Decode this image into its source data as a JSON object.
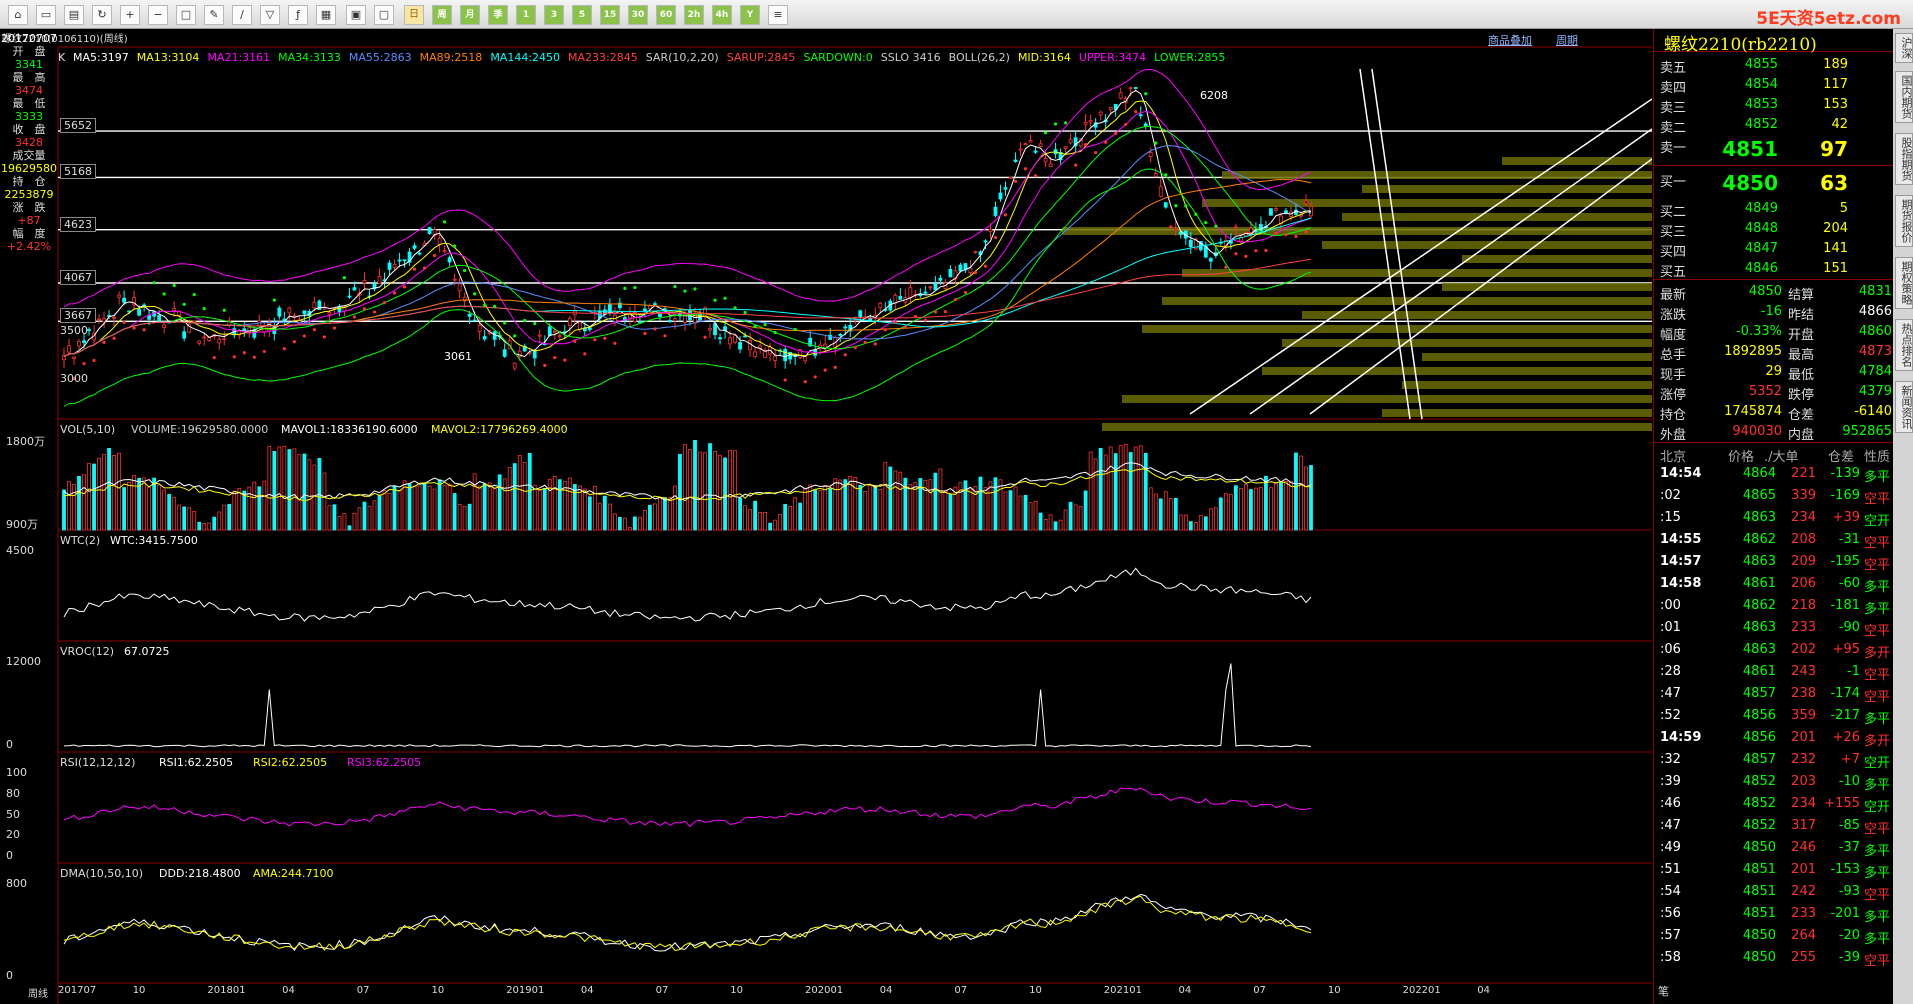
{
  "toolbar": {
    "icons": [
      "home-icon",
      "folder-icon",
      "chart-icon",
      "refresh-icon",
      "zoom-in-icon",
      "zoom-out-icon",
      "window-icon",
      "pencil-icon",
      "brush-icon",
      "filter-icon",
      "formula-icon",
      "table-icon",
      "calc-icon",
      "box-icon",
      "day-label",
      "week-label",
      "month-label",
      "x-label",
      "1-label",
      "3-label",
      "5-label",
      "15-label",
      "30-label",
      "60-label",
      "2h-label",
      "4h-label",
      "y-label",
      "news-icon"
    ],
    "period_buttons": [
      "日",
      "周",
      "月",
      "季",
      "1",
      "3",
      "5",
      "15",
      "30",
      "60",
      "2h",
      "4h",
      "Y"
    ]
  },
  "watermark": "5E天资5etz.com",
  "header": {
    "title": "螺纹2210(0106110)(周线)",
    "k_label": "K",
    "ma_items": [
      {
        "text": "MA5:3197",
        "color": "#ffffff"
      },
      {
        "text": "MA13:3104",
        "color": "#ffff00"
      },
      {
        "text": "MA21:3161",
        "color": "#ff00ff"
      },
      {
        "text": "MA34:3133",
        "color": "#00ff00"
      },
      {
        "text": "MA55:2863",
        "color": "#5a8cff"
      },
      {
        "text": "MA89:2518",
        "color": "#ff8000"
      },
      {
        "text": "MA144:2450",
        "color": "#00ffff"
      },
      {
        "text": "MA233:2845",
        "color": "#ff4040"
      },
      {
        "text": "SAR(10,2,20)",
        "color": "#cccccc"
      },
      {
        "text": "SARUP:2845",
        "color": "#ff4040"
      },
      {
        "text": "SARDOWN:0",
        "color": "#00ff00"
      },
      {
        "text": "SSLO 3416",
        "color": "#cccccc"
      },
      {
        "text": "BOLL(26,2)",
        "color": "#cccccc"
      },
      {
        "text": "MID:3164",
        "color": "#ffff00"
      },
      {
        "text": "UPPER:3474",
        "color": "#ff00ff"
      },
      {
        "text": "LOWER:2855",
        "color": "#00ff00"
      }
    ],
    "link_overlay": "商品叠加",
    "link_period": "周期"
  },
  "left_info": {
    "date": "20170707",
    "rows": [
      {
        "label": "开　盘",
        "value": "3341",
        "color": "#00ff00"
      },
      {
        "label": "最　高",
        "value": "3474",
        "color": "#ff3030"
      },
      {
        "label": "最　低",
        "value": "3333",
        "color": "#00ff00"
      },
      {
        "label": "收　盘",
        "value": "3428",
        "color": "#ff3030"
      },
      {
        "label": "成交量",
        "value": "19629580",
        "color": "#ffff00"
      },
      {
        "label": "持　仓",
        "value": "2253879",
        "color": "#ffff00"
      },
      {
        "label": "涨　跌",
        "value": "+87",
        "color": "#ff3030"
      },
      {
        "label": "幅　度",
        "value": "+2.42%",
        "color": "#ff3030"
      }
    ]
  },
  "main_chart": {
    "levels": [
      "5652",
      "5168",
      "4623",
      "4067",
      "3667",
      "3500",
      "3000"
    ],
    "peak_label": "6208",
    "low_label": "3061"
  },
  "panels": {
    "vol": {
      "title": "VOL(5,10)",
      "items": [
        {
          "text": "VOLUME:19629580.0000",
          "color": "#cccccc"
        },
        {
          "text": "MAVOL1:18336190.6000",
          "color": "#ffffff"
        },
        {
          "text": "MAVOL2:17796269.4000",
          "color": "#ffff00"
        }
      ],
      "ticks": [
        "1800万",
        "900万"
      ]
    },
    "wtc": {
      "title": "WTC(2)",
      "items": [
        {
          "text": "WTC:3415.7500",
          "color": "#ffffff"
        }
      ],
      "ticks": [
        "4500"
      ]
    },
    "vroc": {
      "title": "VROC(12)",
      "items": [
        {
          "text": "67.0725",
          "color": "#ffffff"
        }
      ],
      "ticks": [
        "12000",
        "0"
      ]
    },
    "rsi": {
      "title": "RSI(12,12,12)",
      "items": [
        {
          "text": "RSI1:62.2505",
          "color": "#ffffff"
        },
        {
          "text": "RSI2:62.2505",
          "color": "#ffff00"
        },
        {
          "text": "RSI3:62.2505",
          "color": "#ff00ff"
        }
      ],
      "ticks": [
        "100",
        "80",
        "50",
        "20",
        "0"
      ]
    },
    "dma": {
      "title": "DMA(10,50,10)",
      "items": [
        {
          "text": "DDD:218.4800",
          "color": "#ffffff"
        },
        {
          "text": "AMA:244.7100",
          "color": "#ffff00"
        }
      ],
      "ticks": [
        "800",
        "0"
      ]
    }
  },
  "x_axis": [
    "周线",
    "201707",
    "10",
    "201801",
    "04",
    "07",
    "10",
    "201901",
    "04",
    "07",
    "10",
    "202001",
    "04",
    "07",
    "10",
    "202101",
    "04",
    "07",
    "10",
    "202201",
    "04"
  ],
  "quote": {
    "title": "螺纹2210(rb2210)",
    "asks": [
      {
        "label": "卖五",
        "price": "4855",
        "vol": "189"
      },
      {
        "label": "卖四",
        "price": "4854",
        "vol": "117"
      },
      {
        "label": "卖三",
        "price": "4853",
        "vol": "153"
      },
      {
        "label": "卖二",
        "price": "4852",
        "vol": "42"
      },
      {
        "label": "卖一",
        "price": "4851",
        "vol": "97"
      }
    ],
    "bids": [
      {
        "label": "买一",
        "price": "4850",
        "vol": "63"
      },
      {
        "label": "买二",
        "price": "4849",
        "vol": "5"
      },
      {
        "label": "买三",
        "price": "4848",
        "vol": "204"
      },
      {
        "label": "买四",
        "price": "4847",
        "vol": "141"
      },
      {
        "label": "买五",
        "price": "4846",
        "vol": "151"
      }
    ],
    "stats": [
      {
        "l1": "最新",
        "v1": "4850",
        "c1": "#00ff00",
        "l2": "结算",
        "v2": "4831",
        "c2": "#00ff00"
      },
      {
        "l1": "涨跌",
        "v1": "-16",
        "c1": "#00ff00",
        "l2": "昨结",
        "v2": "4866",
        "c2": "#ffffff"
      },
      {
        "l1": "幅度",
        "v1": "-0.33%",
        "c1": "#00ff00",
        "l2": "开盘",
        "v2": "4860",
        "c2": "#00ff00"
      },
      {
        "l1": "总手",
        "v1": "1892895",
        "c1": "#ffff00",
        "l2": "最高",
        "v2": "4873",
        "c2": "#ff3030"
      },
      {
        "l1": "现手",
        "v1": "29",
        "c1": "#ffff00",
        "l2": "最低",
        "v2": "4784",
        "c2": "#00ff00"
      },
      {
        "l1": "涨停",
        "v1": "5352",
        "c1": "#ff3030",
        "l2": "跌停",
        "v2": "4379",
        "c2": "#00ff00"
      },
      {
        "l1": "持仓",
        "v1": "1745874",
        "c1": "#ffff00",
        "l2": "仓差",
        "v2": "-6140",
        "c2": "#ffff00"
      },
      {
        "l1": "外盘",
        "v1": "940030",
        "c1": "#ff3030",
        "l2": "内盘",
        "v2": "952865",
        "c2": "#00ff00"
      }
    ],
    "ticks_header": [
      "北京",
      "价格",
      "./大单",
      "仓差",
      "性质"
    ],
    "ticks": [
      {
        "t": "14:54",
        "p": "4864",
        "v": "221",
        "d": "-139",
        "n": "多平",
        "nc": "#00ff00",
        "big": true
      },
      {
        "t": ":02",
        "p": "4865",
        "v": "339",
        "d": "-169",
        "n": "空平",
        "nc": "#ff3030",
        "big": false
      },
      {
        "t": ":15",
        "p": "4863",
        "v": "234",
        "d": "+39",
        "n": "空开",
        "nc": "#00ff00",
        "big": false
      },
      {
        "t": "14:55",
        "p": "4862",
        "v": "208",
        "d": "-31",
        "n": "空平",
        "nc": "#ff3030",
        "big": true
      },
      {
        "t": "14:57",
        "p": "4863",
        "v": "209",
        "d": "-195",
        "n": "空平",
        "nc": "#ff3030",
        "big": true
      },
      {
        "t": "14:58",
        "p": "4861",
        "v": "206",
        "d": "-60",
        "n": "多平",
        "nc": "#00ff00",
        "big": true
      },
      {
        "t": ":00",
        "p": "4862",
        "v": "218",
        "d": "-181",
        "n": "多平",
        "nc": "#00ff00",
        "big": false
      },
      {
        "t": ":01",
        "p": "4863",
        "v": "233",
        "d": "-90",
        "n": "空平",
        "nc": "#ff3030",
        "big": false
      },
      {
        "t": ":06",
        "p": "4863",
        "v": "202",
        "d": "+95",
        "n": "多开",
        "nc": "#ff3030",
        "big": false
      },
      {
        "t": ":28",
        "p": "4861",
        "v": "243",
        "d": "-1",
        "n": "空平",
        "nc": "#ff3030",
        "big": false
      },
      {
        "t": ":47",
        "p": "4857",
        "v": "238",
        "d": "-174",
        "n": "空平",
        "nc": "#ff3030",
        "big": false
      },
      {
        "t": ":52",
        "p": "4856",
        "v": "359",
        "d": "-217",
        "n": "多平",
        "nc": "#00ff00",
        "big": false
      },
      {
        "t": "14:59",
        "p": "4856",
        "v": "201",
        "d": "+26",
        "n": "多开",
        "nc": "#ff3030",
        "big": true
      },
      {
        "t": ":32",
        "p": "4857",
        "v": "232",
        "d": "+7",
        "n": "空开",
        "nc": "#00ff00",
        "big": false
      },
      {
        "t": ":39",
        "p": "4852",
        "v": "203",
        "d": "-10",
        "n": "多平",
        "nc": "#00ff00",
        "big": false
      },
      {
        "t": ":46",
        "p": "4852",
        "v": "234",
        "d": "+155",
        "n": "空开",
        "nc": "#00ff00",
        "big": false
      },
      {
        "t": ":47",
        "p": "4852",
        "v": "317",
        "d": "-85",
        "n": "空平",
        "nc": "#ff3030",
        "big": false
      },
      {
        "t": ":49",
        "p": "4850",
        "v": "246",
        "d": "-37",
        "n": "多平",
        "nc": "#00ff00",
        "big": false
      },
      {
        "t": ":51",
        "p": "4851",
        "v": "201",
        "d": "-153",
        "n": "多平",
        "nc": "#00ff00",
        "big": false
      },
      {
        "t": ":54",
        "p": "4851",
        "v": "242",
        "d": "-93",
        "n": "空平",
        "nc": "#ff3030",
        "big": false
      },
      {
        "t": ":56",
        "p": "4851",
        "v": "233",
        "d": "-201",
        "n": "多平",
        "nc": "#00ff00",
        "big": false
      },
      {
        "t": ":57",
        "p": "4850",
        "v": "264",
        "d": "-20",
        "n": "多平",
        "nc": "#00ff00",
        "big": false
      },
      {
        "t": ":58",
        "p": "4850",
        "v": "255",
        "d": "-39",
        "n": "空平",
        "nc": "#ff3030",
        "big": false
      }
    ],
    "bottom_tab": "笔"
  },
  "side_tabs": [
    "沪深",
    "国内期货",
    "股指期货",
    "期货报价",
    "期权策略",
    "热点排名",
    "新闻资讯"
  ]
}
